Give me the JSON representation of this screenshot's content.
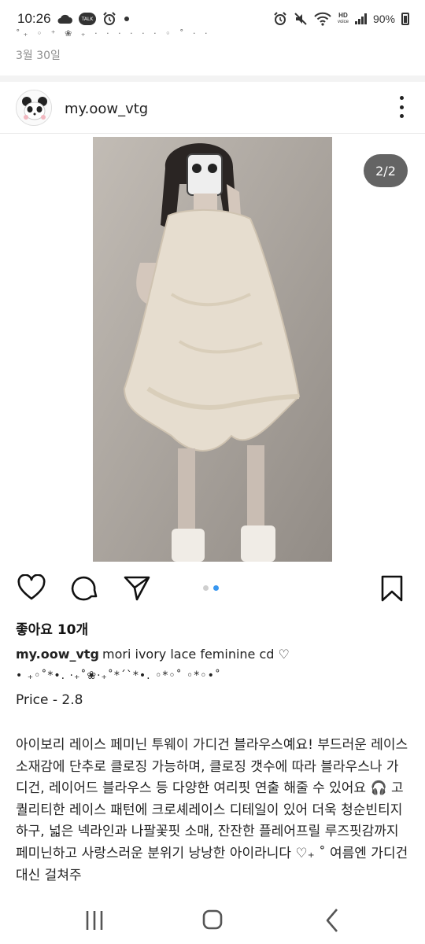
{
  "status_bar": {
    "time": "10:26",
    "talk_label": "TALK",
    "hd_label": "HD",
    "voice_label": "voice",
    "battery": "90%"
  },
  "previous_post": {
    "trailing_decoration": "˚₊ ◦ ⁺ ❀ ₊ · · · · · · ◦ ˚ · ·",
    "date": "3월 30일"
  },
  "post": {
    "username": "my.oow_vtg",
    "image_counter": "2/2",
    "carousel_total": 2,
    "carousel_active": 2,
    "likes": "좋아요 10개",
    "caption_title": "mori ivory lace feminine cd ♡",
    "caption_decoration": "• ₊◦˚*•. ·₊˚❀·₊˚*ˊˋ*•. ◦*◦˚ ◦*◦•˚",
    "price": "Price - 2.8",
    "body": "아이보리 레이스 페미닌 투웨이 가디건 블라우스예요! 부드러운 레이스 소재감에 단추로 클로징 가능하며, 클로징 갯수에 따라 블라우스나 가디건, 레이어드 블라우스 등 다양한 여리핏 연출 해줄 수 있어요 🎧 고퀄리티한 레이스 패턴에 크로셰레이스 디테일이 있어 더욱 청순빈티지하구, 넓은 넥라인과 나팔꽃핏 소매, 잔잔한 플레어프릴 루즈핏감까지 페미닌하고 사랑스러운 분위기 낭낭한 아이라니다 ♡₊ ˚ 여름엔 가디건 대신 걸쳐주"
  },
  "colors": {
    "accent_blue": "#3897f0",
    "heart_pink": "#e8a0a8",
    "text_muted": "#8e8e8e"
  },
  "icons": [
    "cloud-icon",
    "talk-icon",
    "alarm-icon",
    "dot-icon",
    "wifi-icon",
    "signal-icon",
    "battery-icon",
    "more-icon",
    "heart-icon",
    "comment-icon",
    "share-icon",
    "bookmark-icon",
    "recent-apps-icon",
    "home-icon",
    "back-icon"
  ]
}
